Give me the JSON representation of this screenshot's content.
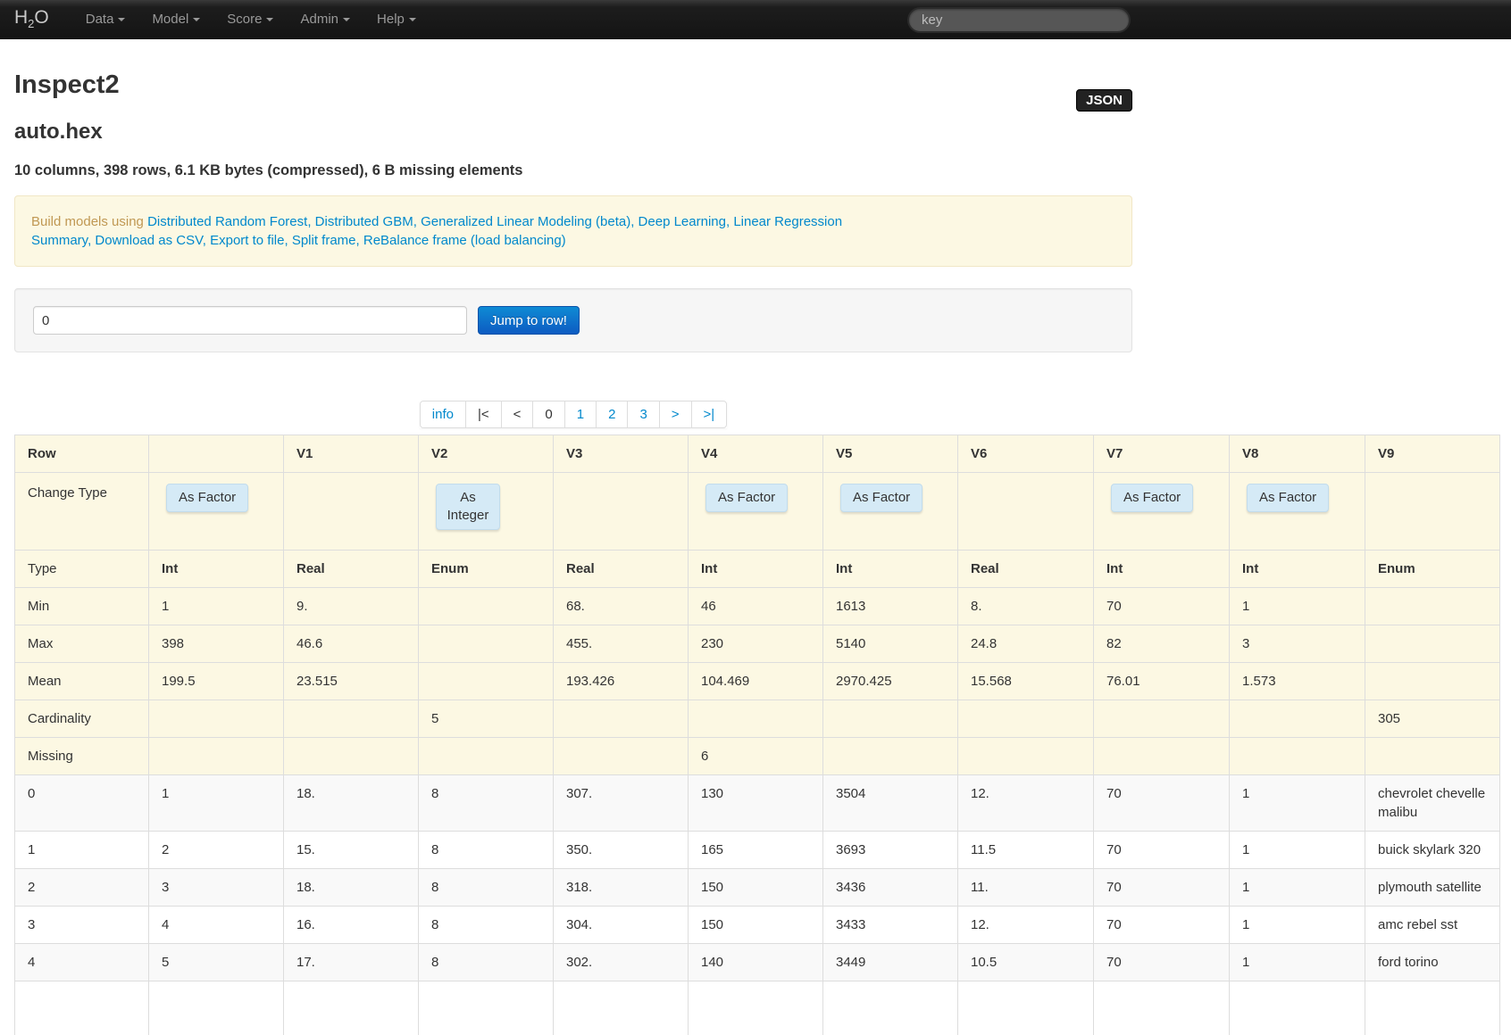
{
  "navbar": {
    "brand": {
      "h": "H",
      "sub": "2",
      "o": "O"
    },
    "menus": [
      {
        "label": "Data"
      },
      {
        "label": "Model"
      },
      {
        "label": "Score"
      },
      {
        "label": "Admin"
      },
      {
        "label": "Help"
      }
    ],
    "search_placeholder": "key"
  },
  "json_button_label": "JSON",
  "page": {
    "title": "Inspect2",
    "frame_name": "auto.hex",
    "summary": "10 columns, 398 rows, 6.1 KB bytes (compressed), 6 B missing elements"
  },
  "build_bar": {
    "prefix": "Build models using ",
    "separator": ", ",
    "model_links": [
      "Distributed Random Forest",
      "Distributed GBM",
      "Generalized Linear Modeling (beta)",
      "Deep Learning",
      "Linear Regression"
    ],
    "action_links": [
      "Summary",
      "Download as CSV",
      "Export to file",
      "Split frame",
      "ReBalance frame (load balancing)"
    ]
  },
  "jump": {
    "input_value": "0",
    "button_label": "Jump to row!"
  },
  "pagination": [
    {
      "name": "info",
      "label": "info",
      "style": "link"
    },
    {
      "name": "first",
      "label": "|<",
      "style": "text"
    },
    {
      "name": "prev",
      "label": "<",
      "style": "text"
    },
    {
      "name": "page-0",
      "label": "0",
      "style": "current"
    },
    {
      "name": "page-1",
      "label": "1",
      "style": "link"
    },
    {
      "name": "page-2",
      "label": "2",
      "style": "link"
    },
    {
      "name": "page-3",
      "label": "3",
      "style": "link"
    },
    {
      "name": "next",
      "label": ">",
      "style": "link"
    },
    {
      "name": "last",
      "label": ">|",
      "style": "link"
    }
  ],
  "table": {
    "header": [
      "Row",
      "",
      "V1",
      "V2",
      "V3",
      "V4",
      "V5",
      "V6",
      "V7",
      "V8",
      "V9"
    ],
    "change_type": {
      "label": "Change Type",
      "buttons": [
        "As Factor",
        "",
        "As Integer",
        "",
        "As Factor",
        "As Factor",
        "",
        "As Factor",
        "As Factor",
        ""
      ]
    },
    "stat_rows": [
      {
        "kind": "boldvals",
        "cells": [
          "Type",
          "Int",
          "Real",
          "Enum",
          "Real",
          "Int",
          "Int",
          "Real",
          "Int",
          "Int",
          "Enum"
        ]
      },
      {
        "kind": "stat",
        "cells": [
          "Min",
          "1",
          "9.",
          "",
          "68.",
          "46",
          "1613",
          "8.",
          "70",
          "1",
          ""
        ]
      },
      {
        "kind": "stat",
        "cells": [
          "Max",
          "398",
          "46.6",
          "",
          "455.",
          "230",
          "5140",
          "24.8",
          "82",
          "3",
          ""
        ]
      },
      {
        "kind": "stat",
        "cells": [
          "Mean",
          "199.5",
          "23.515",
          "",
          "193.426",
          "104.469",
          "2970.425",
          "15.568",
          "76.01",
          "1.573",
          ""
        ]
      },
      {
        "kind": "stat",
        "cells": [
          "Cardinality",
          "",
          "",
          "5",
          "",
          "",
          "",
          "",
          "",
          "",
          "305"
        ]
      },
      {
        "kind": "stat",
        "cells": [
          "Missing",
          "",
          "",
          "",
          "",
          "6",
          "",
          "",
          "",
          "",
          ""
        ]
      }
    ],
    "data_rows": [
      [
        "0",
        "1",
        "18.",
        "8",
        "307.",
        "130",
        "3504",
        "12.",
        "70",
        "1",
        "chevrolet chevelle malibu"
      ],
      [
        "1",
        "2",
        "15.",
        "8",
        "350.",
        "165",
        "3693",
        "11.5",
        "70",
        "1",
        "buick skylark 320"
      ],
      [
        "2",
        "3",
        "18.",
        "8",
        "318.",
        "150",
        "3436",
        "11.",
        "70",
        "1",
        "plymouth satellite"
      ],
      [
        "3",
        "4",
        "16.",
        "8",
        "304.",
        "150",
        "3433",
        "12.",
        "70",
        "1",
        "amc rebel sst"
      ],
      [
        "4",
        "5",
        "17.",
        "8",
        "302.",
        "140",
        "3449",
        "10.5",
        "70",
        "1",
        "ford torino"
      ]
    ],
    "partial_row": [
      "",
      "",
      "",
      "",
      "",
      "",
      "",
      "",
      "",
      "",
      ""
    ]
  }
}
